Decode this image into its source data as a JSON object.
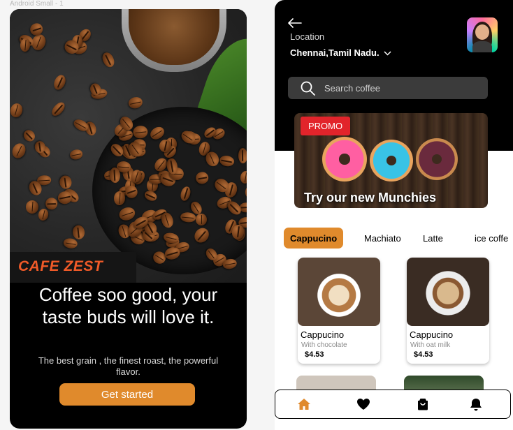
{
  "frame_label": "Android Small - 1",
  "splash": {
    "brand": "CAFE ZEST",
    "headline": "Coffee soo good, your taste buds will love it.",
    "subline": "The best grain , the finest roast, the powerful flavor.",
    "cta_label": "Get started"
  },
  "home": {
    "location_label": "Location",
    "location_value": "Chennai,Tamil Nadu.",
    "search_placeholder": "Search coffee",
    "promo": {
      "badge": "PROMO",
      "title": "Try our new Munchies"
    },
    "tabs": [
      {
        "label": "Cappucino",
        "active": true
      },
      {
        "label": "Machiato",
        "active": false
      },
      {
        "label": "Latte",
        "active": false
      },
      {
        "label": "ice coffe",
        "active": false
      }
    ],
    "products": [
      {
        "name": "Cappucino",
        "desc": "With chocolate",
        "price": "$4.53"
      },
      {
        "name": "Cappucino",
        "desc": "With oat milk",
        "price": "$4.53"
      }
    ],
    "nav": [
      {
        "icon": "home-icon",
        "active": true
      },
      {
        "icon": "heart-icon",
        "active": false
      },
      {
        "icon": "bag-icon",
        "active": false
      },
      {
        "icon": "bell-icon",
        "active": false
      }
    ]
  },
  "colors": {
    "accent": "#e08a2c",
    "brand": "#f05a28",
    "promo_badge": "#e2242b",
    "dark": "#000000"
  }
}
